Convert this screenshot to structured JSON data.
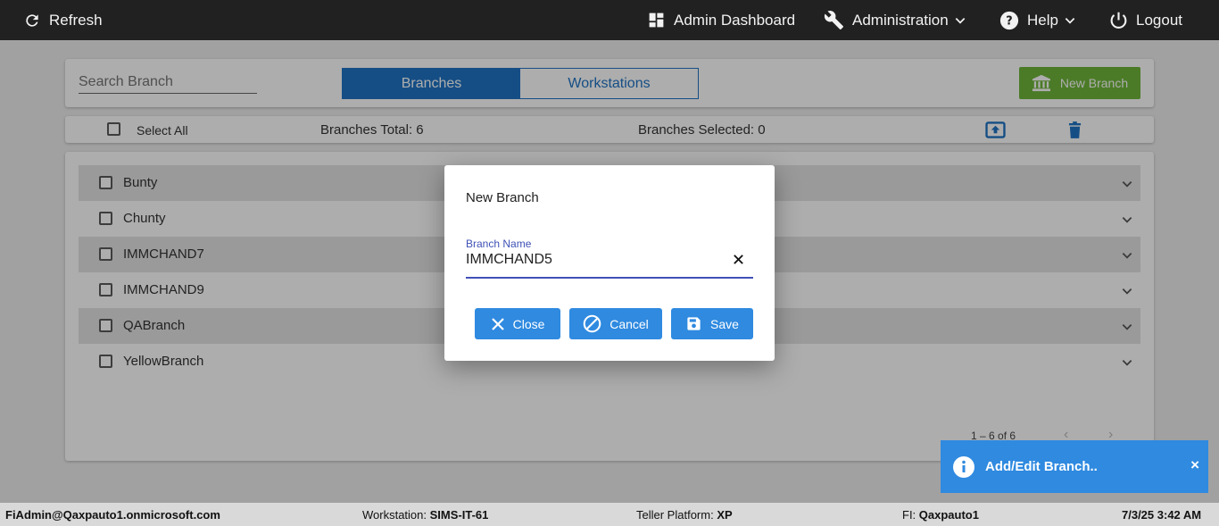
{
  "topbar": {
    "refresh": "Refresh",
    "admin_dashboard": "Admin Dashboard",
    "administration": "Administration",
    "help": "Help",
    "logout": "Logout"
  },
  "search": {
    "placeholder": "Search Branch"
  },
  "tabs": [
    {
      "label": "Branches",
      "active": true
    },
    {
      "label": "Workstations",
      "active": false
    }
  ],
  "new_branch_button": "New Branch",
  "toolbar": {
    "select_all": "Select All",
    "branches_total": "Branches Total: 6",
    "branches_selected": "Branches Selected: 0"
  },
  "branches": [
    {
      "name": "Bunty"
    },
    {
      "name": "Chunty"
    },
    {
      "name": "IMMCHAND7"
    },
    {
      "name": "IMMCHAND9"
    },
    {
      "name": "QABranch"
    },
    {
      "name": "YellowBranch"
    }
  ],
  "paginator": {
    "range": "1 – 6 of 6"
  },
  "dialog": {
    "title": "New Branch",
    "field_label": "Branch Name",
    "field_value": "IMMCHAND5",
    "close": "Close",
    "cancel": "Cancel",
    "save": "Save"
  },
  "toast": {
    "message": "Add/Edit Branch.."
  },
  "footer": {
    "user": "FiAdmin@Qaxpauto1.onmicrosoft.com",
    "workstation_label": "Workstation: ",
    "workstation_value": "SIMS-IT-61",
    "platform_label": "Teller Platform: ",
    "platform_value": "XP",
    "fi_label": "FI: ",
    "fi_value": "Qaxpauto1",
    "datetime": "7/3/25 3:42 AM"
  },
  "colors": {
    "topbar": "#212121",
    "primary": "#1f74c4",
    "dialog_button": "#2f8ae0",
    "new_branch": "#6fb53a",
    "input_accent": "#3f51b5"
  }
}
